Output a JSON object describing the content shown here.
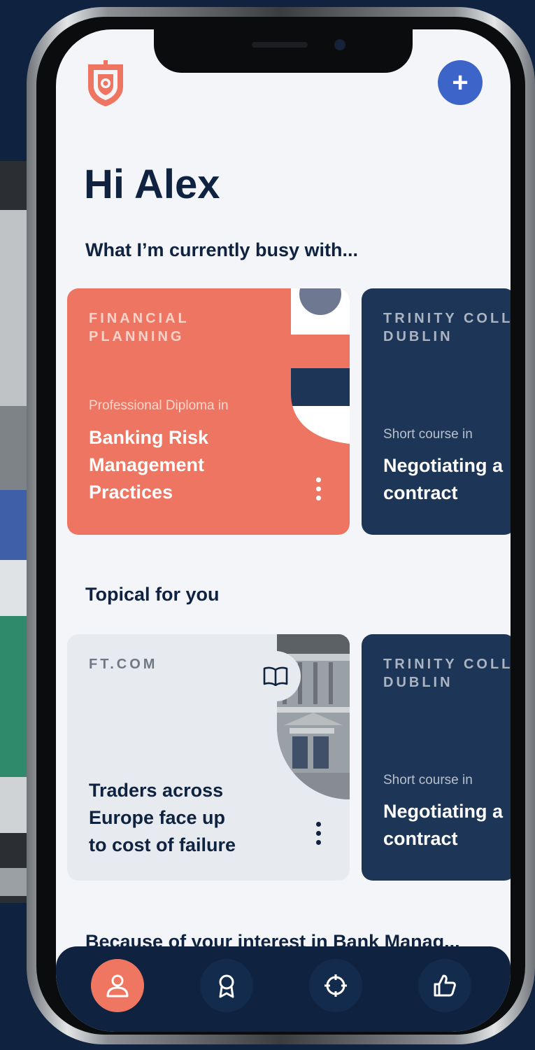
{
  "header": {
    "greeting": "Hi Alex",
    "add_label": "+"
  },
  "sections": {
    "current": "What I’m currently busy with...",
    "topical": "Topical for you",
    "interest": "Because of your interest in Bank Manag..."
  },
  "current_cards": [
    {
      "kicker": "FINANCIAL\nPLANNING",
      "subtitle": "Professional Diploma in",
      "title": "Banking Risk\nManagement\nPractices",
      "color": "#ee7561"
    },
    {
      "kicker": "TRINITY COLL\nDUBLIN",
      "subtitle": "Short course in",
      "title": "Negotiating a\ncontract",
      "color": "#1d3556"
    }
  ],
  "topical_cards": [
    {
      "source": "FT.COM",
      "title": "Traders across\nEurope face up\nto cost of failure"
    },
    {
      "kicker": "TRINITY COLL\nDUBLIN",
      "subtitle": "Short course in",
      "title": "Negotiating a\ncontract"
    }
  ],
  "tabs": [
    {
      "icon": "user-icon",
      "active": true
    },
    {
      "icon": "award-icon",
      "active": false
    },
    {
      "icon": "target-icon",
      "active": false
    },
    {
      "icon": "thumbs-up-icon",
      "active": false
    }
  ],
  "colors": {
    "navy": "#0f2340",
    "coral": "#ee7561",
    "blue": "#3d64c8",
    "screen_bg": "#f3f5f9"
  }
}
